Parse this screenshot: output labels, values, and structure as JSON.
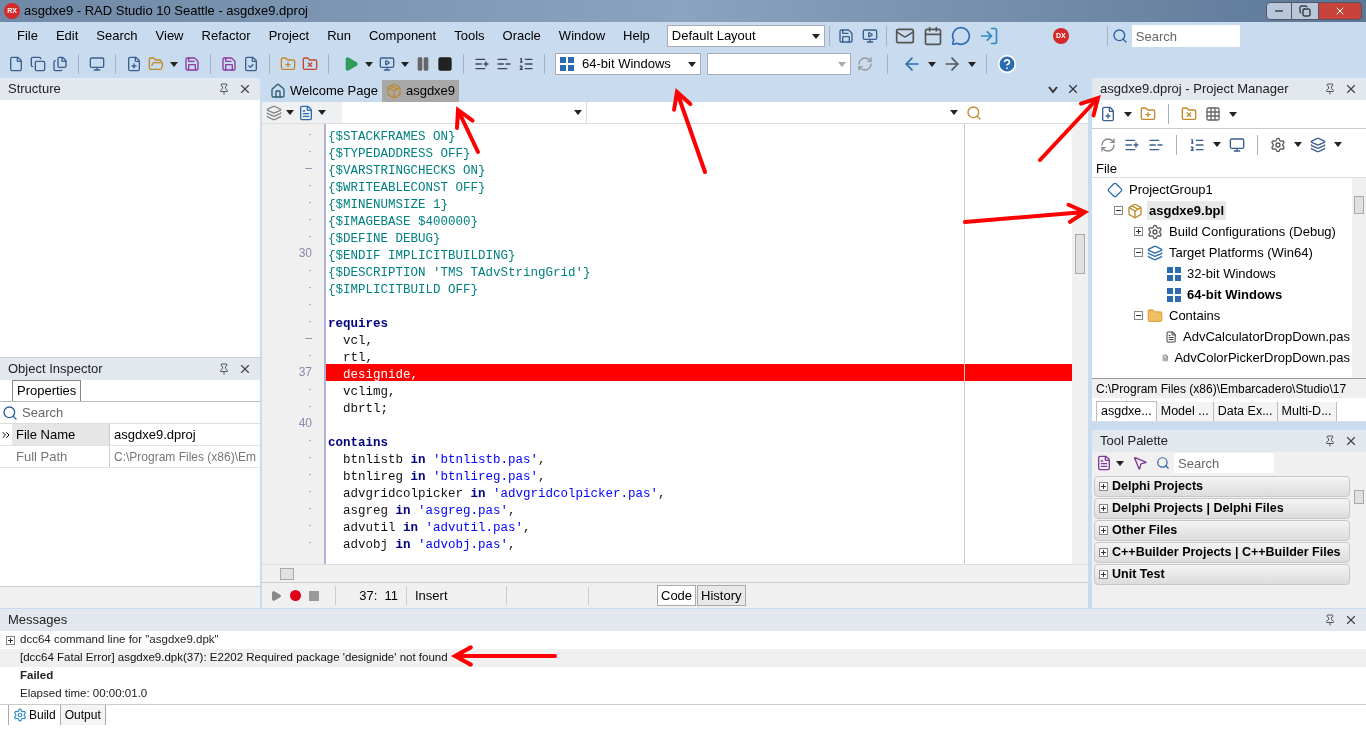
{
  "window": {
    "title": "asgdxe9 - RAD Studio 10 Seattle - asgdxe9.dproj",
    "badge": "RX"
  },
  "menu": [
    "File",
    "Edit",
    "Search",
    "View",
    "Refactor",
    "Project",
    "Run",
    "Component",
    "Tools",
    "Oracle",
    "Window",
    "Help"
  ],
  "layout_combo": {
    "value": "Default Layout"
  },
  "dx_badge": "DX",
  "search": {
    "placeholder": "Search"
  },
  "platform_combo": {
    "value": "64-bit Windows"
  },
  "structure": {
    "title": "Structure"
  },
  "object_inspector": {
    "title": "Object Inspector",
    "tabs": [
      {
        "label": "Properties",
        "selected": true
      }
    ],
    "search_placeholder": "Search",
    "rows": [
      {
        "name": "File Name",
        "value": "asgdxe9.dproj",
        "selected": true,
        "readonly": false
      },
      {
        "name": "Full Path",
        "value": "C:\\Program Files (x86)\\Em",
        "selected": false,
        "readonly": true
      }
    ]
  },
  "editor": {
    "tabs": [
      {
        "label": "Welcome Page",
        "selected": false
      },
      {
        "label": "asgdxe9",
        "selected": true
      }
    ],
    "lines": [
      {
        "gutter": "·",
        "error": false,
        "segs": [
          {
            "kind": "directive",
            "text": "{$STACKFRAMES ON}"
          }
        ]
      },
      {
        "gutter": "·",
        "error": false,
        "segs": [
          {
            "kind": "directive",
            "text": "{$TYPEDADDRESS OFF}"
          }
        ]
      },
      {
        "gutter": "–",
        "error": false,
        "segs": [
          {
            "kind": "directive",
            "text": "{$VARSTRINGCHECKS ON}"
          }
        ]
      },
      {
        "gutter": "·",
        "error": false,
        "segs": [
          {
            "kind": "directive",
            "text": "{$WRITEABLECONST OFF}"
          }
        ]
      },
      {
        "gutter": "·",
        "error": false,
        "segs": [
          {
            "kind": "directive",
            "text": "{$MINENUMSIZE 1}"
          }
        ]
      },
      {
        "gutter": "·",
        "error": false,
        "segs": [
          {
            "kind": "directive",
            "text": "{$IMAGEBASE $400000}"
          }
        ]
      },
      {
        "gutter": "·",
        "error": false,
        "segs": [
          {
            "kind": "directive",
            "text": "{$DEFINE DEBUG}"
          }
        ]
      },
      {
        "gutter": "30",
        "error": false,
        "segs": [
          {
            "kind": "directive",
            "text": "{$ENDIF IMPLICITBUILDING}"
          }
        ]
      },
      {
        "gutter": "·",
        "error": false,
        "segs": [
          {
            "kind": "directive",
            "text": "{$DESCRIPTION 'TMS TAdvStringGrid'}"
          }
        ]
      },
      {
        "gutter": "·",
        "error": false,
        "segs": [
          {
            "kind": "directive",
            "text": "{$IMPLICITBUILD OFF}"
          }
        ]
      },
      {
        "gutter": "·",
        "error": false
      },
      {
        "gutter": "·",
        "error": false,
        "segs": [
          {
            "kind": "keyword",
            "text": "requires"
          }
        ]
      },
      {
        "gutter": "–",
        "error": false,
        "segs": [
          {
            "kind": "ident",
            "text": "  vcl,"
          }
        ]
      },
      {
        "gutter": "·",
        "error": false,
        "segs": [
          {
            "kind": "ident",
            "text": "  rtl,"
          }
        ]
      },
      {
        "gutter": "37",
        "error": true,
        "segs": [
          {
            "kind": "ident",
            "text": "  designide,"
          }
        ]
      },
      {
        "gutter": "·",
        "error": false,
        "segs": [
          {
            "kind": "ident",
            "text": "  vclimg,"
          }
        ]
      },
      {
        "gutter": "·",
        "error": false,
        "segs": [
          {
            "kind": "ident",
            "text": "  dbrtl;"
          }
        ]
      },
      {
        "gutter": "40",
        "error": false
      },
      {
        "gutter": "·",
        "error": false,
        "segs": [
          {
            "kind": "keyword",
            "text": "contains"
          }
        ]
      },
      {
        "gutter": "·",
        "error": false,
        "segs": [
          {
            "kind": "ident",
            "text": "  btnlistb "
          },
          {
            "kind": "keyword",
            "text": "in"
          },
          {
            "kind": "string",
            "text": " 'btnlistb.pas'"
          },
          {
            "kind": "ident",
            "text": ","
          }
        ]
      },
      {
        "gutter": "·",
        "error": false,
        "segs": [
          {
            "kind": "ident",
            "text": "  btnlireg "
          },
          {
            "kind": "keyword",
            "text": "in"
          },
          {
            "kind": "string",
            "text": " 'btnlireg.pas'"
          },
          {
            "kind": "ident",
            "text": ","
          }
        ]
      },
      {
        "gutter": "·",
        "error": false,
        "segs": [
          {
            "kind": "ident",
            "text": "  advgridcolpicker "
          },
          {
            "kind": "keyword",
            "text": "in"
          },
          {
            "kind": "string",
            "text": " 'advgridcolpicker.pas'"
          },
          {
            "kind": "ident",
            "text": ","
          }
        ]
      },
      {
        "gutter": "·",
        "error": false,
        "segs": [
          {
            "kind": "ident",
            "text": "  asgreg "
          },
          {
            "kind": "keyword",
            "text": "in"
          },
          {
            "kind": "string",
            "text": " 'asgreg.pas'"
          },
          {
            "kind": "ident",
            "text": ","
          }
        ]
      },
      {
        "gutter": "·",
        "error": false,
        "segs": [
          {
            "kind": "ident",
            "text": "  advutil "
          },
          {
            "kind": "keyword",
            "text": "in"
          },
          {
            "kind": "string",
            "text": " 'advutil.pas'"
          },
          {
            "kind": "ident",
            "text": ","
          }
        ]
      },
      {
        "gutter": "·",
        "error": false,
        "segs": [
          {
            "kind": "ident",
            "text": "  advobj "
          },
          {
            "kind": "keyword",
            "text": "in"
          },
          {
            "kind": "string",
            "text": " 'advobj.pas'"
          },
          {
            "kind": "ident",
            "text": ","
          }
        ]
      }
    ],
    "position": "37:  11",
    "mode": "Insert",
    "view_tabs": [
      {
        "label": "Code",
        "selected": true
      },
      {
        "label": "History",
        "selected": false
      }
    ]
  },
  "project_manager": {
    "title": "asgdxe9.dproj - Project Manager",
    "column": "File",
    "tree": [
      {
        "label": "ProjectGroup1",
        "kind": "group",
        "bold": false,
        "selected": false,
        "children": [
          {
            "label": "asgdxe9.bpl",
            "kind": "package",
            "bold": true,
            "selected": true,
            "expanded": true,
            "children": [
              {
                "label": "Build Configurations (Debug)",
                "kind": "config",
                "bold": false,
                "selected": false,
                "expanded": false
              },
              {
                "label": "Target Platforms (Win64)",
                "kind": "platforms",
                "bold": false,
                "selected": false,
                "expanded": true,
                "children": [
                  {
                    "label": "32-bit Windows",
                    "kind": "platform",
                    "bold": false,
                    "selected": false
                  },
                  {
                    "label": "64-bit Windows",
                    "kind": "platform",
                    "bold": true,
                    "selected": false
                  }
                ]
              },
              {
                "label": "Contains",
                "kind": "folder",
                "bold": false,
                "selected": false,
                "expanded": true,
                "children": [
                  {
                    "label": "AdvCalculatorDropDown.pas",
                    "kind": "file",
                    "bold": false,
                    "selected": false
                  },
                  {
                    "label": "AdvColorPickerDropDown.pas",
                    "kind": "file",
                    "bold": false,
                    "selected": false
                  }
                ]
              }
            ]
          }
        ]
      }
    ],
    "path": "C:\\Program Files (x86)\\Embarcadero\\Studio\\17",
    "tabs": [
      {
        "label": "asgdxe...",
        "selected": true
      },
      {
        "label": "Model ...",
        "selected": false
      },
      {
        "label": "Data Ex...",
        "selected": false
      },
      {
        "label": "Multi-D...",
        "selected": false
      }
    ]
  },
  "tool_palette": {
    "title": "Tool Palette",
    "search_placeholder": "Search",
    "categories": [
      "Delphi Projects",
      "Delphi Projects | Delphi Files",
      "Other Files",
      "C++Builder Projects | C++Builder Files",
      "Unit Test"
    ]
  },
  "messages": {
    "title": "Messages",
    "rows": [
      {
        "kind": "group",
        "text": "dcc64 command line for \"asgdxe9.dpk\"",
        "selected": false
      },
      {
        "kind": "error",
        "text": "[dcc64 Fatal Error] asgdxe9.dpk(37): E2202 Required package 'designide' not found",
        "selected": true
      },
      {
        "kind": "status",
        "text": "Failed",
        "selected": false
      },
      {
        "kind": "plain",
        "text": "Elapsed time: 00:00:01.0",
        "selected": false
      }
    ],
    "tabs": [
      {
        "label": "Build",
        "selected": true
      },
      {
        "label": "Output",
        "selected": false
      }
    ]
  }
}
